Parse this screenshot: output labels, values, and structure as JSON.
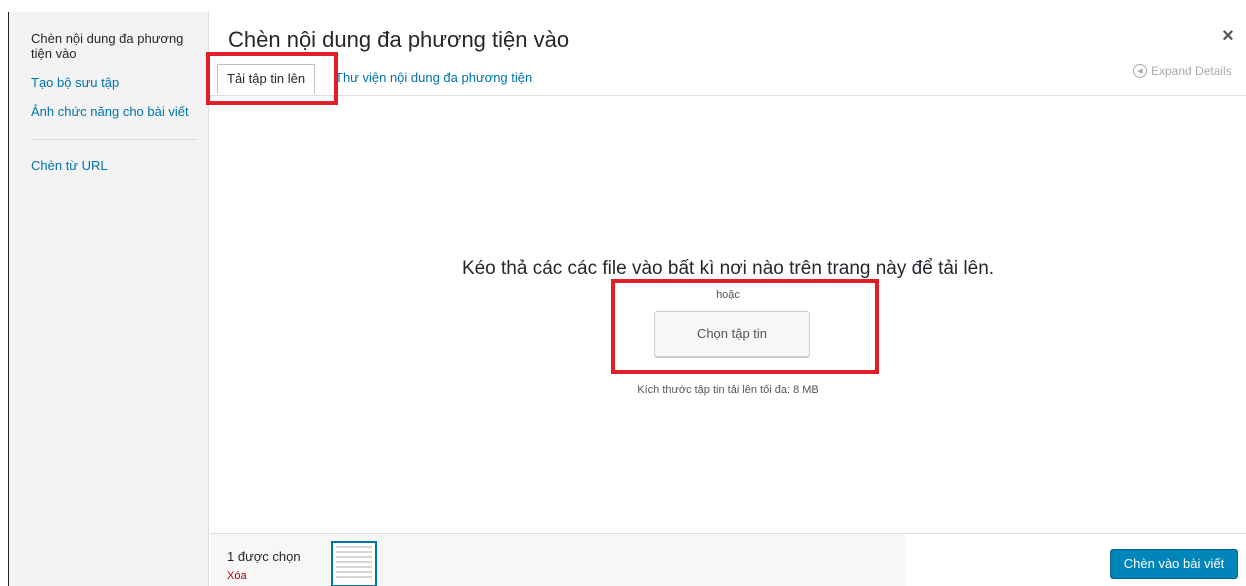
{
  "sidebar": {
    "items": [
      {
        "label": "Chèn nội dung đa phương tiện vào"
      },
      {
        "label": "Tạo bộ sưu tập"
      },
      {
        "label": "Ảnh chức năng cho bài viết"
      },
      {
        "label": "Chèn từ URL"
      }
    ]
  },
  "header": {
    "title": "Chèn nội dung đa phương tiện vào",
    "close_icon": "×"
  },
  "tabs": {
    "upload": "Tải tập tin lên",
    "library": "Thư viện nội dung đa phương tiện"
  },
  "expand_details": "Expand Details",
  "upload": {
    "drop_text": "Kéo thả các các file vào bất kì nơi nào trên trang này để tải lên.",
    "or_text": "hoặc",
    "select_button": "Chọn tập tin",
    "max_size": "Kích thước tập tin tải lên tối đa: 8 MB"
  },
  "toolbar": {
    "selected_count": "1 được chọn",
    "clear": "Xóa",
    "insert_button": "Chèn vào bài viết"
  },
  "colors": {
    "accent": "#0073aa",
    "primary_button": "#0085ba",
    "highlight": "#e11d27",
    "danger": "#aa0000"
  }
}
